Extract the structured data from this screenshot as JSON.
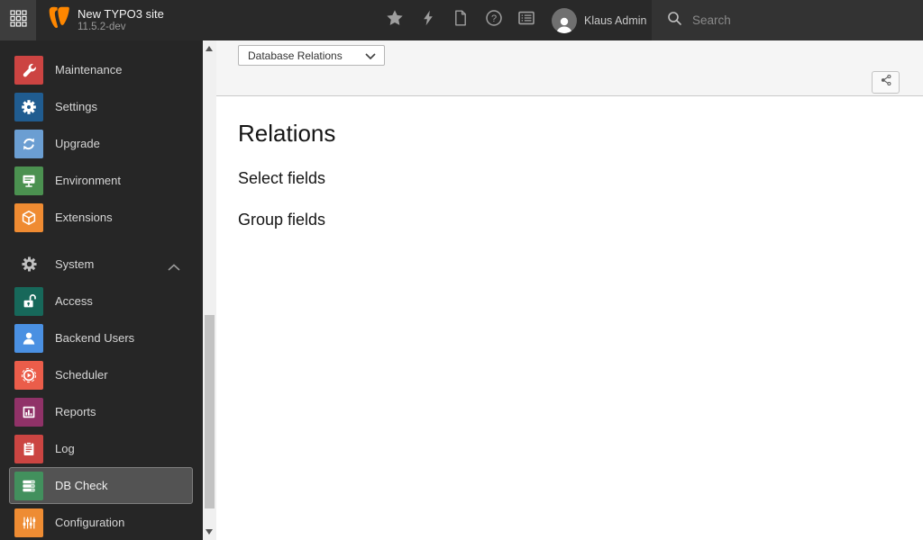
{
  "topbar": {
    "site_title": "New TYPO3 site",
    "site_version": "11.5.2-dev",
    "username": "Klaus Admin",
    "search_placeholder": "Search",
    "icons": [
      "modules-grid-icon",
      "star-icon",
      "bolt-icon",
      "document-icon",
      "help-icon",
      "list-icon",
      "search-icon"
    ]
  },
  "sidebar": {
    "admin_group": [
      {
        "label": "Maintenance",
        "icon": "wrench-icon",
        "tile_color": "#cc4442"
      },
      {
        "label": "Settings",
        "icon": "gear-icon",
        "tile_color": "#205c90"
      },
      {
        "label": "Upgrade",
        "icon": "refresh-icon",
        "tile_color": "#6b9ed2"
      },
      {
        "label": "Environment",
        "icon": "monitor-icon",
        "tile_color": "#4b9150"
      },
      {
        "label": "Extensions",
        "icon": "cube-icon",
        "tile_color": "#ef8b32"
      }
    ],
    "system_group": {
      "header": "System",
      "collapsed": false,
      "items": [
        {
          "label": "Access",
          "icon": "padlock-open-icon",
          "tile_color": "#17685a"
        },
        {
          "label": "Backend Users",
          "icon": "user-icon",
          "tile_color": "#4a90e2"
        },
        {
          "label": "Scheduler",
          "icon": "play-circle-icon",
          "tile_color": "#eb5d4a"
        },
        {
          "label": "Reports",
          "icon": "bar-chart-icon",
          "tile_color": "#903268"
        },
        {
          "label": "Log",
          "icon": "clipboard-icon",
          "tile_color": "#cb4542"
        },
        {
          "label": "DB Check",
          "icon": "database-icon",
          "tile_color": "#42905d",
          "active": true
        },
        {
          "label": "Configuration",
          "icon": "sliders-icon",
          "tile_color": "#ee8c33"
        }
      ]
    }
  },
  "docheader": {
    "module_select_value": "Database Relations",
    "share_icon": "share-icon"
  },
  "content": {
    "heading": "Relations",
    "sections": [
      "Select fields",
      "Group fields"
    ]
  },
  "colors": {
    "brand_orange": "#ff8700",
    "topbar_bg": "#292929",
    "topbar_search_bg": "#333333",
    "sidebar_bg": "#262626",
    "active_row_bg": "#535353",
    "docheader_bg": "#f5f5f5"
  }
}
